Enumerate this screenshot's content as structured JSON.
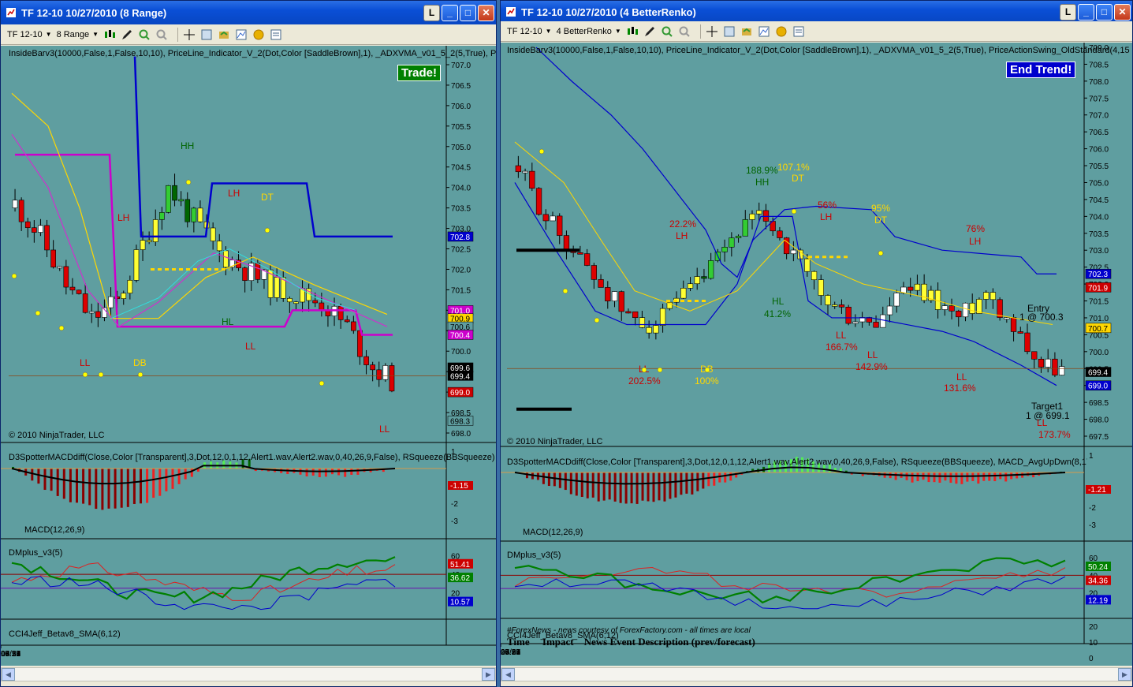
{
  "left": {
    "title": "TF 12-10  10/27/2010 (8 Range)",
    "instrument": "TF 12-10",
    "period": "8 Range",
    "badge": "Trade!",
    "badge_color": "#008000",
    "indicator_label": "InsideBarv3(10000,False,1,False,10,10), PriceLine_Indicator_V_2(Dot,Color [SaddleBrown],1), _ADXVMA_v01_5_2(5,True), P",
    "copyright": "© 2010 NinjaTrader, LLC",
    "macd_label": "D3SpotterMACDdiff(Close,Color [Transparent],3,Dot,12,0,1,12,Alert1.wav,Alert2.wav,0,40,26,9,False), RSqueeze(BBSqueeze),",
    "macd_sub": "MACD(12,26,9)",
    "dm_label": "DMplus_v3(5)",
    "cci_label": "CCI4Jeff_Betav8_SMA(6,12)",
    "price_ticks": [
      "707.0",
      "706.5",
      "706.0",
      "705.5",
      "705.0",
      "704.5",
      "704.0",
      "703.5",
      "703.0",
      "702.5",
      "702.0",
      "701.5",
      "701.0",
      "700.5",
      "700.0",
      "699.5",
      "699.0",
      "698.5",
      "698.0"
    ],
    "price_tags": [
      {
        "text": "702.8",
        "bg": "#0000cd",
        "fg": "#ffffff",
        "price": 702.8
      },
      {
        "text": "701.0",
        "bg": "#cc00cc",
        "fg": "#ffffff",
        "price": 701.0
      },
      {
        "text": "700.9",
        "bg": "#ffd700",
        "fg": "#000000",
        "price": 700.8
      },
      {
        "text": "700.6",
        "bg": "#5f9ea0",
        "fg": "#000000",
        "price": 700.6
      },
      {
        "text": "700.4",
        "bg": "#cc00cc",
        "fg": "#ffffff",
        "price": 700.4
      },
      {
        "text": "699.6",
        "bg": "#000000",
        "fg": "#ffffff",
        "price": 699.6
      },
      {
        "text": "699.4",
        "bg": "#000000",
        "fg": "#ffffff",
        "price": 699.4
      },
      {
        "text": "699.0",
        "bg": "#cc0000",
        "fg": "#ffffff",
        "price": 699.0
      },
      {
        "text": "698.3",
        "bg": "#5f9ea0",
        "fg": "#000000",
        "price": 698.3
      }
    ],
    "macd_ticks": [
      "1",
      "-1",
      "-2",
      "-3"
    ],
    "macd_tag": "-1.15",
    "dm_ticks": [
      "60",
      "40",
      "20"
    ],
    "dm_tags": [
      {
        "text": "51.41",
        "bg": "#cc0000",
        "value": 51.41
      },
      {
        "text": "36.62",
        "bg": "#008000",
        "value": 36.62
      },
      {
        "text": "10.57",
        "bg": "#0000cd",
        "value": 10.57
      }
    ],
    "time_ticks": [
      "10/27",
      "03:13",
      "04:51",
      "05:53",
      "07:34",
      "08:30",
      "08:52",
      "09:28",
      "09:32"
    ],
    "annotations": [
      {
        "text": "HH",
        "color": "#006400"
      },
      {
        "text": "LH",
        "color": "#cc0000"
      },
      {
        "text": "LH",
        "color": "#cc0000"
      },
      {
        "text": "DT",
        "color": "#ffd700"
      },
      {
        "text": "HL",
        "color": "#006400"
      },
      {
        "text": "LL",
        "color": "#cc0000"
      },
      {
        "text": "LL",
        "color": "#cc0000"
      },
      {
        "text": "DB",
        "color": "#ffd700"
      },
      {
        "text": "LL",
        "color": "#cc0000"
      }
    ]
  },
  "right": {
    "title": "TF 12-10  10/27/2010 (4 BetterRenko)",
    "instrument": "TF 12-10",
    "period": "4 BetterRenko",
    "badge": "End Trend!",
    "badge_color": "#0000cd",
    "indicator_label": "InsideBarv3(10000,False,1,False,10,10), PriceLine_Indicator_V_2(Dot,Color [SaddleBrown],1), _ADXVMA_v01_5_2(5,True), PriceActionSwing_OldStandard(4,15,",
    "copyright": "© 2010 NinjaTrader, LLC",
    "macd_label": "D3SpotterMACDdiff(Close,Color [Transparent],3,Dot,12,0,1,12,Alert1.wav,Alert2.wav,0,40,26,9,False), RSqueeze(BBSqueeze), MACD_AvgUpDwn(8,17,9)",
    "macd_sub": "MACD(12,26,9)",
    "dm_label": "DMplus_v3(5)",
    "cci_label": "CCI4Jeff_Betav8_SMA(6,12)",
    "news_line": "#ForexNews - news courtesy of ForexFactory.com - all times are local",
    "news_header": "Time     Impact    News Event Description (prev/forecast)",
    "price_ticks": [
      "709.0",
      "708.5",
      "708.0",
      "707.5",
      "707.0",
      "706.5",
      "706.0",
      "705.5",
      "705.0",
      "704.5",
      "704.0",
      "703.5",
      "703.0",
      "702.5",
      "702.0",
      "701.5",
      "701.0",
      "700.5",
      "700.0",
      "699.5",
      "699.0",
      "698.5",
      "698.0",
      "697.5"
    ],
    "price_tags": [
      {
        "text": "702.3",
        "bg": "#0000cd",
        "fg": "#ffffff",
        "price": 702.3
      },
      {
        "text": "701.9",
        "bg": "#cc0000",
        "fg": "#ffffff",
        "price": 701.9
      },
      {
        "text": "700.7",
        "bg": "#ffd700",
        "fg": "#000000",
        "price": 700.7
      },
      {
        "text": "699.4",
        "bg": "#000000",
        "fg": "#ffffff",
        "price": 699.4
      },
      {
        "text": "699.0",
        "bg": "#0000cd",
        "fg": "#ffffff",
        "price": 699.0
      }
    ],
    "macd_ticks": [
      "1",
      "-1",
      "-2",
      "-3"
    ],
    "macd_tag": "-1.21",
    "dm_ticks": [
      "60",
      "40",
      "20"
    ],
    "dm_tags": [
      {
        "text": "50.24",
        "bg": "#008000",
        "value": 50.24
      },
      {
        "text": "34.36",
        "bg": "#cc0000",
        "value": 34.36
      },
      {
        "text": "12.19",
        "bg": "#0000cd",
        "value": 12.19
      }
    ],
    "cci_ticks": [
      "20",
      "10",
      "0"
    ],
    "time_ticks": [
      "23:14",
      "10/27",
      "03:08",
      "04:02",
      "05:32",
      "05:57",
      "07:22",
      "08:30",
      "08:32",
      "08:58",
      "09:25",
      "09:31"
    ],
    "annotations": [
      {
        "text": "188.9%",
        "color": "#006400"
      },
      {
        "text": "HH",
        "color": "#006400"
      },
      {
        "text": "107.1%",
        "color": "#ffd700"
      },
      {
        "text": "DT",
        "color": "#ffd700"
      },
      {
        "text": "22.2%",
        "color": "#cc0000"
      },
      {
        "text": "LH",
        "color": "#cc0000"
      },
      {
        "text": "56%",
        "color": "#cc0000"
      },
      {
        "text": "LH",
        "color": "#cc0000"
      },
      {
        "text": "95%",
        "color": "#ffd700"
      },
      {
        "text": "DT",
        "color": "#ffd700"
      },
      {
        "text": "76%",
        "color": "#cc0000"
      },
      {
        "text": "LH",
        "color": "#cc0000"
      },
      {
        "text": "HL",
        "color": "#006400"
      },
      {
        "text": "41.2%",
        "color": "#006400"
      },
      {
        "text": "LL",
        "color": "#cc0000"
      },
      {
        "text": "166.7%",
        "color": "#cc0000"
      },
      {
        "text": "LL",
        "color": "#cc0000"
      },
      {
        "text": "142.9%",
        "color": "#cc0000"
      },
      {
        "text": "LL",
        "color": "#cc0000"
      },
      {
        "text": "202.5%",
        "color": "#cc0000"
      },
      {
        "text": "DB",
        "color": "#ffd700"
      },
      {
        "text": "100%",
        "color": "#ffd700"
      },
      {
        "text": "LL",
        "color": "#cc0000"
      },
      {
        "text": "131.6%",
        "color": "#cc0000"
      },
      {
        "text": "Entry",
        "color": "#000000"
      },
      {
        "text": "1 @ 700.3",
        "color": "#000000"
      },
      {
        "text": "Target1",
        "color": "#000000"
      },
      {
        "text": "1 @ 699.1",
        "color": "#000000"
      },
      {
        "text": "LL",
        "color": "#cc0000"
      },
      {
        "text": "173.7%",
        "color": "#cc0000"
      }
    ]
  }
}
